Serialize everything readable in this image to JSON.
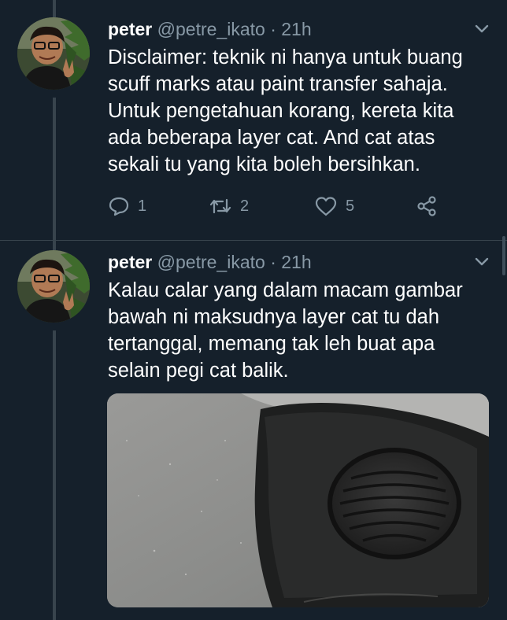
{
  "tweets": [
    {
      "display_name": "peter",
      "handle": "@petre_ikato",
      "separator": "·",
      "time": "21h",
      "text_lines": [
        "Disclaimer: teknik ni hanya untuk buang",
        "scuff marks atau paint transfer sahaja.",
        "Untuk pengetahuan korang, kereta kita",
        "ada beberapa layer cat. And cat atas",
        "sekali tu yang kita boleh bersihkan."
      ],
      "reply_count": "1",
      "retweet_count": "2",
      "like_count": "5"
    },
    {
      "display_name": "peter",
      "handle": "@petre_ikato",
      "separator": "·",
      "time": "21h",
      "text_lines": [
        "Kalau calar yang dalam macam gambar",
        "bawah ni maksudnya layer cat tu dah",
        "tertanggal, memang tak leh buat apa",
        "selain pegi cat balik."
      ]
    }
  ],
  "colors": {
    "background": "#15202b",
    "text_primary": "#ffffff",
    "text_secondary": "#8899a6",
    "thread_line": "#38444d"
  },
  "icons": [
    "chevron-down-icon",
    "reply-icon",
    "retweet-icon",
    "like-icon",
    "share-icon"
  ]
}
